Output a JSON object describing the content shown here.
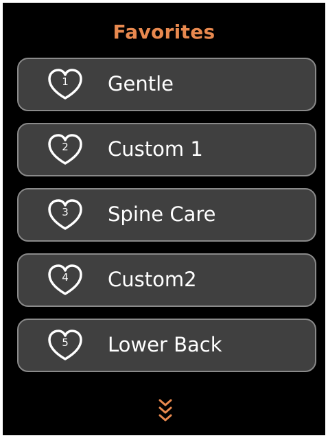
{
  "header": {
    "title": "Favorites"
  },
  "favorites": [
    {
      "number": "1",
      "label": "Gentle",
      "icon": "heart-icon"
    },
    {
      "number": "2",
      "label": "Custom 1",
      "icon": "heart-icon"
    },
    {
      "number": "3",
      "label": "Spine Care",
      "icon": "heart-icon"
    },
    {
      "number": "4",
      "label": "Custom2",
      "icon": "heart-icon"
    },
    {
      "number": "5",
      "label": "Lower Back",
      "icon": "heart-icon"
    }
  ],
  "scroll": {
    "icon": "chevron-down-icon"
  },
  "colors": {
    "background": "#000000",
    "title": "#e8894f",
    "item_fill": "#404040",
    "item_border": "#8a8a8a",
    "text": "#ffffff",
    "scroll_indicator": "#e8894f"
  }
}
